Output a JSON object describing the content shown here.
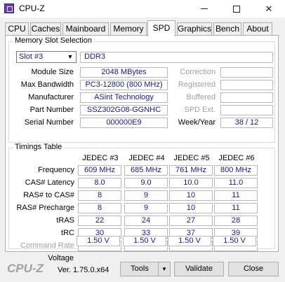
{
  "window": {
    "title": "CPU-Z",
    "minimize": "—",
    "maximize": "☐",
    "close": "✕"
  },
  "tabs": [
    {
      "label": "CPU"
    },
    {
      "label": "Caches"
    },
    {
      "label": "Mainboard"
    },
    {
      "label": "Memory"
    },
    {
      "label": "SPD"
    },
    {
      "label": "Graphics"
    },
    {
      "label": "Bench"
    },
    {
      "label": "About"
    }
  ],
  "memory_slot": {
    "group_title": "Memory Slot Selection",
    "slot_value": "Slot #3",
    "memory_type": "DDR3",
    "labels": {
      "module_size": "Module Size",
      "max_bandwidth": "Max Bandwidth",
      "manufacturer": "Manufacturer",
      "part_number": "Part Number",
      "serial_number": "Serial Number",
      "correction": "Correction",
      "registered": "Registered",
      "buffered": "Buffered",
      "spd_ext": "SPD Ext.",
      "week_year": "Week/Year"
    },
    "values": {
      "module_size": "2048 MBytes",
      "max_bandwidth": "PC3-12800 (800 MHz)",
      "manufacturer": "ASint Technology",
      "part_number": "SSZ302G08-GGNHC",
      "serial_number": "000000E9",
      "week_year": "38 / 12"
    }
  },
  "timings": {
    "group_title": "Timings Table",
    "columns": [
      "JEDEC #3",
      "JEDEC #4",
      "JEDEC #5",
      "JEDEC #6"
    ],
    "rows": [
      {
        "label": "Frequency",
        "values": [
          "609 MHz",
          "685 MHz",
          "761 MHz",
          "800 MHz"
        ]
      },
      {
        "label": "CAS# Latency",
        "values": [
          "8.0",
          "9.0",
          "10.0",
          "11.0"
        ]
      },
      {
        "label": "RAS# to CAS#",
        "values": [
          "8",
          "9",
          "10",
          "11"
        ]
      },
      {
        "label": "RAS# Precharge",
        "values": [
          "8",
          "9",
          "10",
          "11"
        ]
      },
      {
        "label": "tRAS",
        "values": [
          "22",
          "24",
          "27",
          "28"
        ]
      },
      {
        "label": "tRC",
        "values": [
          "30",
          "33",
          "37",
          "39"
        ]
      },
      {
        "label": "Command Rate",
        "values": [
          "",
          "",
          "",
          ""
        ]
      },
      {
        "label": "Voltage",
        "values": [
          "1.50 V",
          "1.50 V",
          "1.50 V",
          "1.50 V"
        ]
      }
    ]
  },
  "footer": {
    "logo": "CPU-Z",
    "version": "Ver. 1.75.0.x64",
    "tools_label": "Tools",
    "validate_label": "Validate",
    "close_label": "Close"
  },
  "colors": {
    "value_text": "#1a1a80",
    "logo": "#a0a0a0",
    "accent": "#6a3ea8"
  }
}
